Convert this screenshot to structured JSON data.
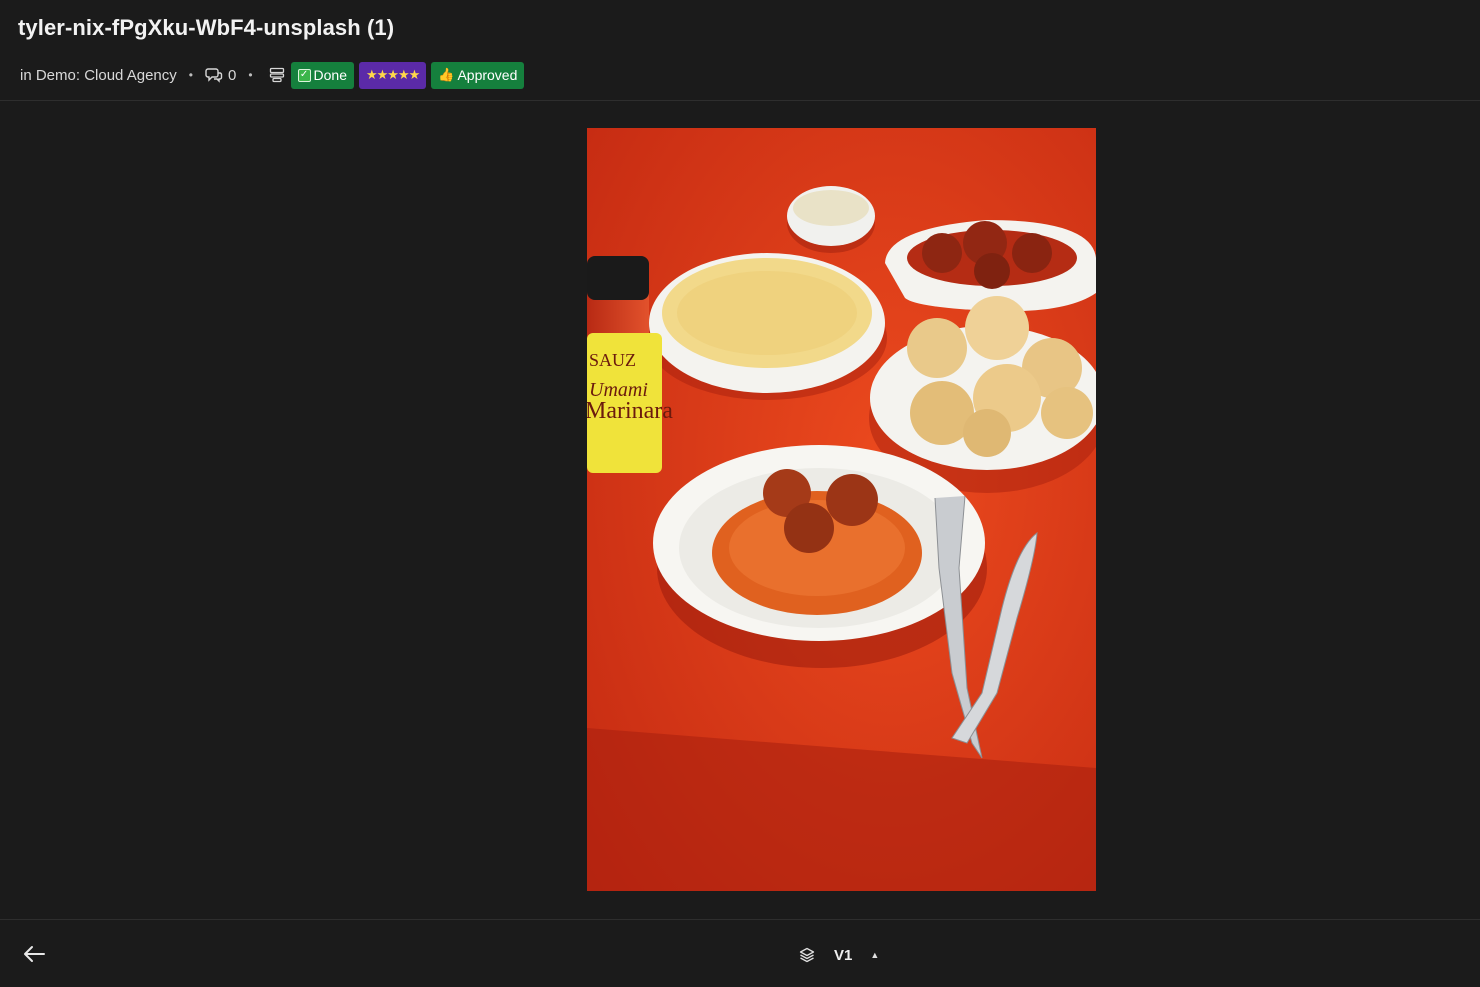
{
  "header": {
    "title": "tyler-nix-fPgXku-WbF4-unsplash (1)",
    "location": "in Demo: Cloud Agency",
    "comment_count": "0",
    "tags": {
      "done": "Done",
      "rating": "★★★★★",
      "approved": "Approved"
    }
  },
  "photo": {
    "jar_brand": "SAUZ",
    "jar_line1": "Umami",
    "jar_line2": "Marinara"
  },
  "footer": {
    "version": "V1"
  },
  "colors": {
    "background": "#1b1b1b",
    "tag_green": "#15803d",
    "tag_purple": "#5b2aa8",
    "tablecloth": "#d93518"
  }
}
